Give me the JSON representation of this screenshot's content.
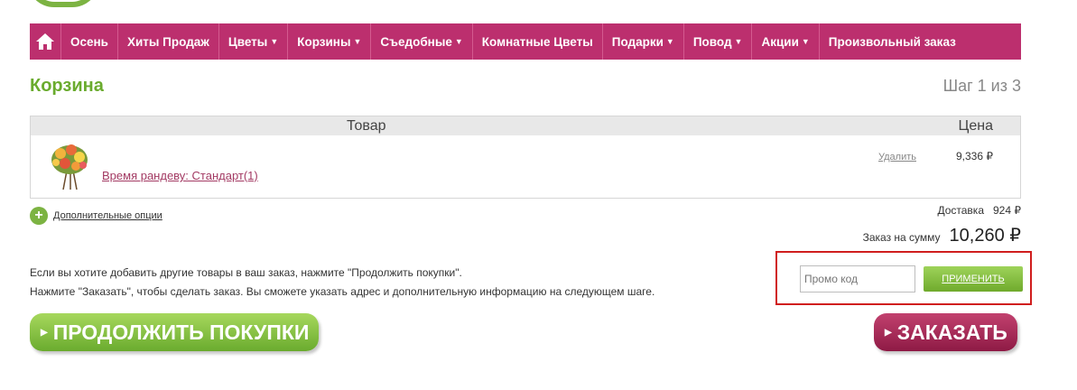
{
  "nav": {
    "items": [
      {
        "label": "Осень",
        "dropdown": false
      },
      {
        "label": "Хиты Продаж",
        "dropdown": false
      },
      {
        "label": "Цветы",
        "dropdown": true
      },
      {
        "label": "Корзины",
        "dropdown": true
      },
      {
        "label": "Съедобные",
        "dropdown": true
      },
      {
        "label": "Комнатные Цветы",
        "dropdown": false
      },
      {
        "label": "Подарки",
        "dropdown": true
      },
      {
        "label": "Повод",
        "dropdown": true
      },
      {
        "label": "Акции",
        "dropdown": true
      },
      {
        "label": "Произвольный заказ",
        "dropdown": false
      }
    ]
  },
  "page": {
    "title": "Корзина",
    "step": "Шаг 1 из 3"
  },
  "cart": {
    "header_product": "Товар",
    "header_price": "Цена",
    "item": {
      "name": "Время рандеву: Стандарт(1)",
      "remove": "Удалить",
      "price": "9,336 ₽"
    }
  },
  "options": {
    "label": "Дополнительные опции"
  },
  "summary": {
    "delivery_label": "Доставка",
    "delivery_value": "924 ₽",
    "total_label": "Заказ на сумму",
    "total_value": "10,260 ₽"
  },
  "info": {
    "line1": "Если вы хотите добавить другие товары в ваш заказ, нажмите \"Продолжить покупки\".",
    "line2": "Нажмите \"Заказать\", чтобы сделать заказ. Вы сможете указать адрес и дополнительную информацию на следующем шаге."
  },
  "promo": {
    "placeholder": "Промо код",
    "apply": "ПРИМЕНИТЬ"
  },
  "actions": {
    "continue": "ПРОДОЛЖИТЬ ПОКУПКИ",
    "order": "ЗАКАЗАТЬ"
  },
  "colors": {
    "nav_bg": "#bc2f6e",
    "accent_green": "#6aab2e",
    "order_btn": "#a32654",
    "highlight": "#d01e1e"
  }
}
